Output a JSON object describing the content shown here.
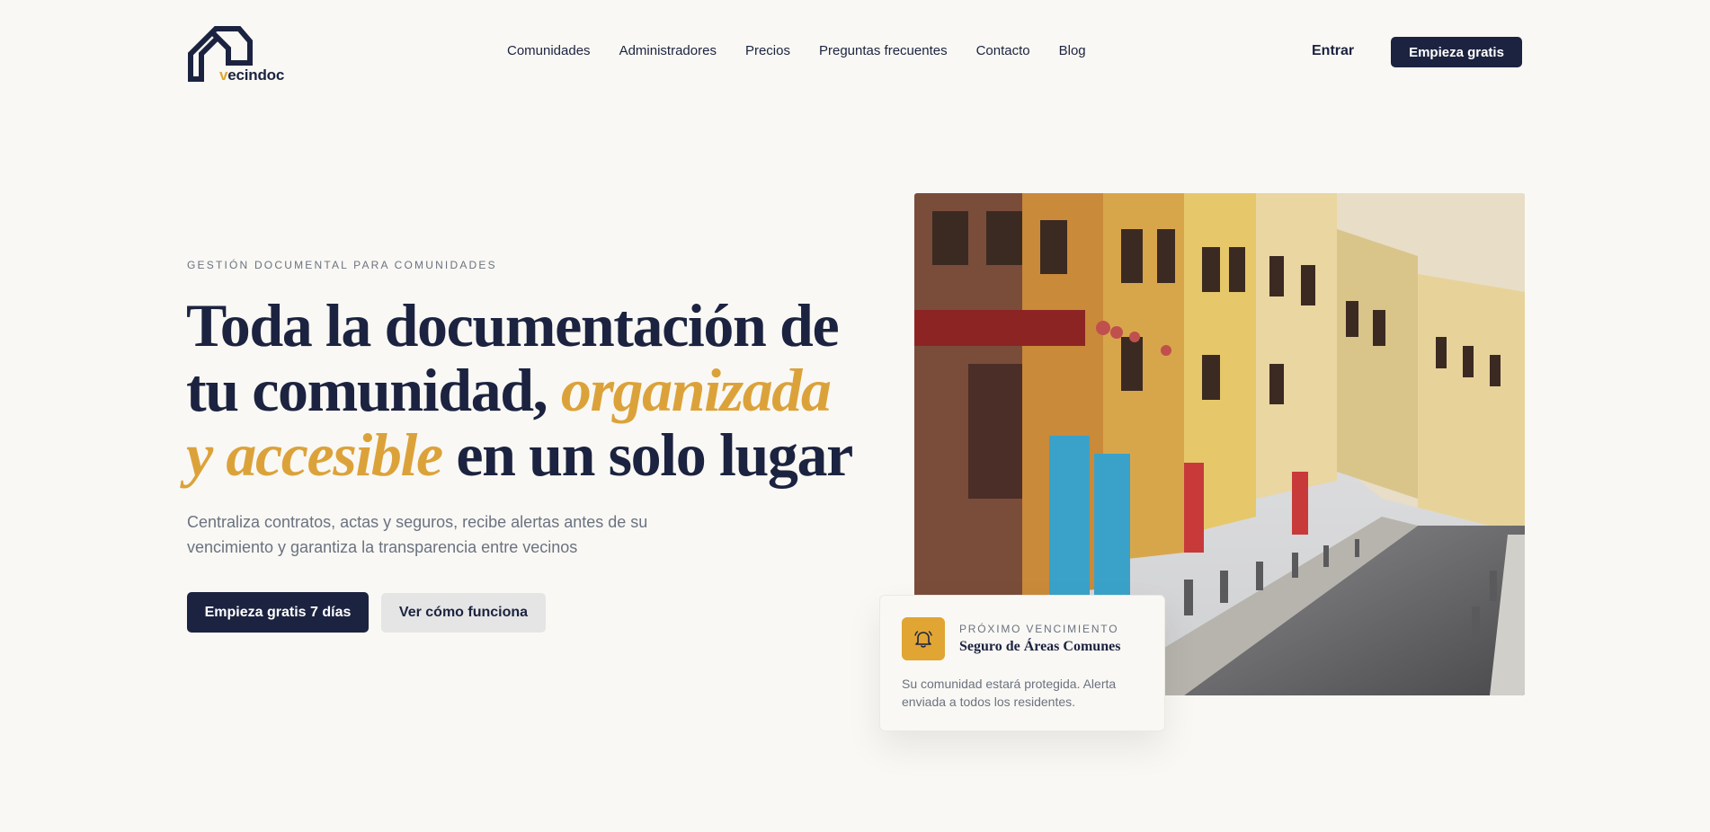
{
  "brand": {
    "name_v": "v",
    "name_rest": "ecindoc",
    "logo_icon": "house-outline-icon",
    "colors": {
      "navy": "#1c2340",
      "gold": "#e0a533",
      "background": "#f9f8f4",
      "muted": "#6b7280"
    }
  },
  "nav": {
    "items": [
      {
        "label": "Comunidades"
      },
      {
        "label": "Administradores"
      },
      {
        "label": "Precios"
      },
      {
        "label": "Preguntas frecuentes"
      },
      {
        "label": "Contacto"
      },
      {
        "label": "Blog"
      }
    ],
    "login_label": "Entrar",
    "cta_label": "Empieza gratis"
  },
  "hero": {
    "eyebrow": "GESTIÓN DOCUMENTAL PARA COMUNIDADES",
    "headline_part1": "Toda la documentación de tu comunidad, ",
    "headline_accent": "organizada y accesible",
    "headline_part2": " en un solo lugar",
    "subtitle": "Centraliza contratos, actas y seguros, recibe alertas antes de su vencimiento y garantiza la transparencia entre vecinos",
    "primary_cta": "Empieza gratis 7 días",
    "secondary_cta": "Ver cómo funciona",
    "image": "street-with-colorful-buildings-photo"
  },
  "notification": {
    "icon": "bell-icon",
    "kicker": "PRÓXIMO VENCIMIENTO",
    "title": "Seguro de Áreas Comunes",
    "body": "Su comunidad estará protegida. Alerta enviada a todos los residentes."
  }
}
